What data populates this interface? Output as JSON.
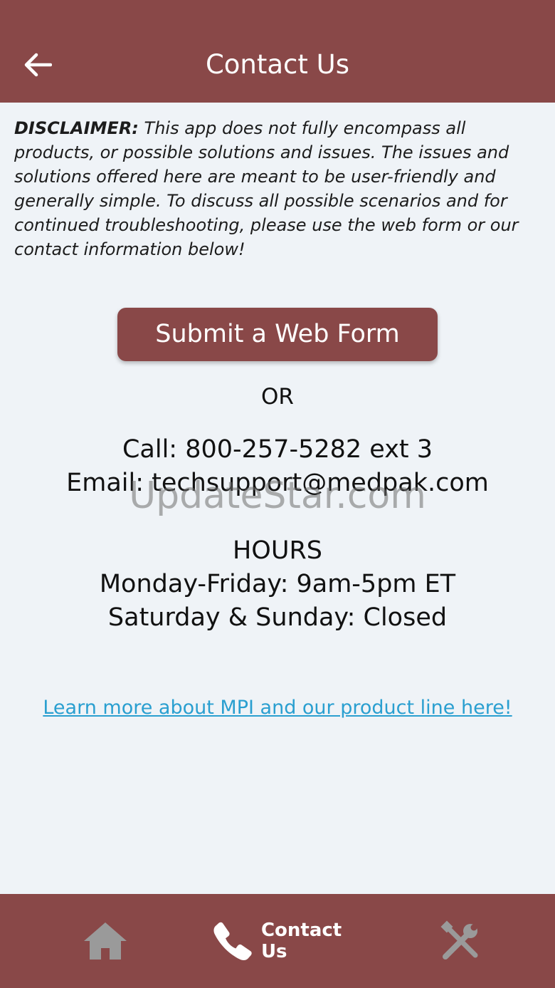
{
  "header": {
    "title": "Contact Us",
    "back_icon": "arrow-left-icon"
  },
  "disclaimer": {
    "label": "DISCLAIMER:",
    "text": " This app does not fully encompass all products, or possible solutions and issues. The issues and solutions offered here are meant to be user-friendly and generally simple. To discuss all possible scenarios and for continued troubleshooting, please use the web form or our contact information below!"
  },
  "webform_button": {
    "label": "Submit a Web Form"
  },
  "or_text": "OR",
  "contact": {
    "call": "Call: 800-257-5282 ext 3",
    "email": "Email: techsupport@medpak.com"
  },
  "hours": {
    "title": "HOURS",
    "weekday": "Monday-Friday: 9am-5pm ET",
    "weekend": "Saturday & Sunday: Closed"
  },
  "watermark": "UpdateStar.com",
  "learn_more_link": "Learn more about MPI and our product line here!",
  "bottom_nav": {
    "home_icon": "home-icon",
    "contact_icon": "phone-icon",
    "contact_label": "Contact Us",
    "tools_icon": "tools-icon"
  },
  "colors": {
    "brand": "#894848",
    "background": "#eff3f7",
    "link": "#2a9fd0",
    "inactive_icon": "#9a9a9a"
  }
}
